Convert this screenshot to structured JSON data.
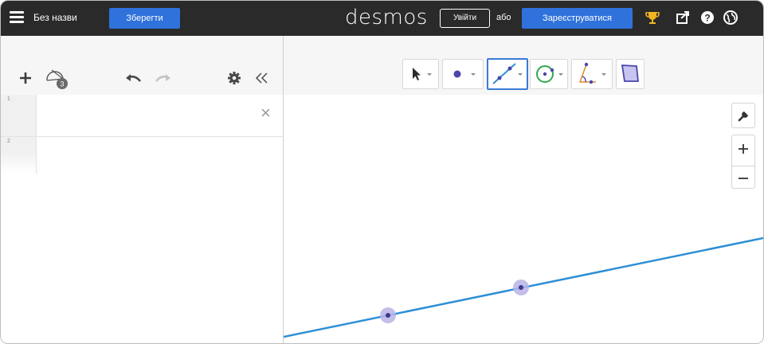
{
  "header": {
    "menu_icon": "hamburger-menu-icon",
    "doc_title": "Без назви",
    "save_label": "Зберегти",
    "logo": "desmos",
    "login_label": "Увійти",
    "or_label": "або",
    "register_label": "Зареєструватися",
    "icons": [
      "trophy-icon",
      "share-icon",
      "help-icon",
      "language-globe-icon"
    ]
  },
  "expressions_toolbar": {
    "icons": [
      "add-icon",
      "geometry-tool-icon",
      "undo-icon",
      "redo-icon",
      "settings-gear-icon",
      "collapse-panel-icon"
    ],
    "geometry_badge": "3"
  },
  "geometry_toolbar": {
    "tools": [
      {
        "name": "select-tool",
        "icon": "pointer-icon",
        "active": false
      },
      {
        "name": "point-tool",
        "icon": "point-icon",
        "active": false
      },
      {
        "name": "line-tool",
        "icon": "line-icon",
        "active": true
      },
      {
        "name": "circle-tool",
        "icon": "circle-icon",
        "active": false
      },
      {
        "name": "angle-tool",
        "icon": "angle-icon",
        "active": false
      },
      {
        "name": "polygon-tool",
        "icon": "polygon-icon",
        "active": false
      }
    ]
  },
  "expressions": [
    {
      "index": "1"
    },
    {
      "index": "2"
    }
  ],
  "graph_controls": {
    "icons": [
      "wrench-icon",
      "zoom-in-icon",
      "zoom-out-icon"
    ]
  },
  "colors": {
    "header_bg": "#2a2a2a",
    "primary_button": "#2f72dc",
    "line": "#2d8fd5",
    "point_halo": "#b9b4e6",
    "point_center": "#3d3a8c",
    "trophy": "#f1b521",
    "active_tool_border": "#3a7bd5"
  }
}
